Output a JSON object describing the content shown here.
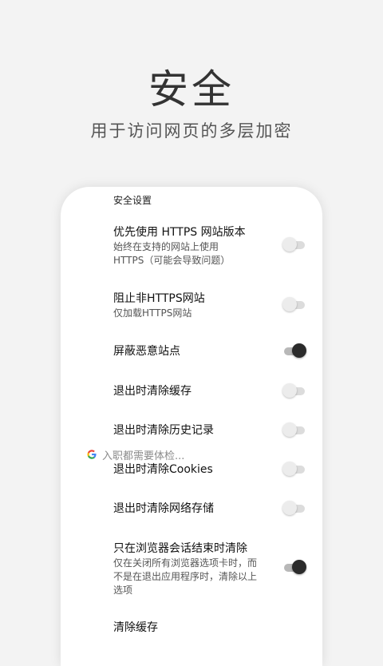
{
  "hero": {
    "title": "安全",
    "subtitle": "用于访问网页的多层加密"
  },
  "settings": {
    "section_title": "安全设置",
    "items": [
      {
        "title": "优先使用 HTTPS 网站版本",
        "desc": "始终在支持的网站上使用 HTTPS（可能会导致问题）",
        "on": false
      },
      {
        "title": "阻止非HTTPS网站",
        "desc": "仅加载HTTPS网站",
        "on": false
      },
      {
        "title": "屏蔽恶意站点",
        "desc": "",
        "on": true
      },
      {
        "title": "退出时清除缓存",
        "desc": "",
        "on": false
      },
      {
        "title": "退出时清除历史记录",
        "desc": "",
        "on": false
      },
      {
        "title": "退出时清除Cookies",
        "desc": "",
        "on": false
      },
      {
        "title": "退出时清除网络存储",
        "desc": "",
        "on": false
      },
      {
        "title": "只在浏览器会话结束时清除",
        "desc": "仅在关闭所有浏览器选项卡时，而不是在退出应用程序时，清除以上选项",
        "on": true
      },
      {
        "title": "清除缓存",
        "desc": "",
        "on": null
      }
    ]
  },
  "search_overlay": {
    "text": "入职都需要体检..."
  }
}
